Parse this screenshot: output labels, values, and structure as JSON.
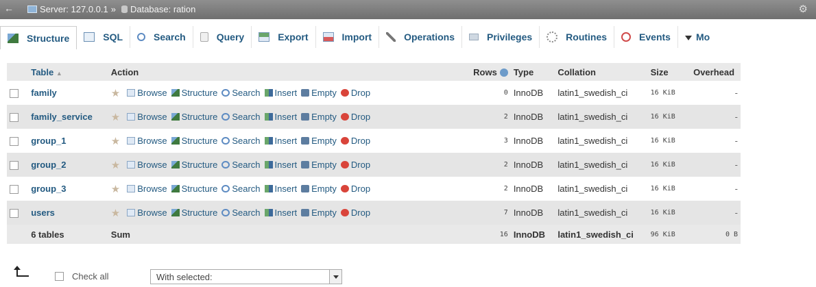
{
  "breadcrumb": {
    "server_label": "Server: 127.0.0.1",
    "separator": "»",
    "database_label": "Database: ration"
  },
  "tabs": [
    {
      "label": "Structure",
      "icon": "structure-icon",
      "active": true
    },
    {
      "label": "SQL",
      "icon": "sql-icon"
    },
    {
      "label": "Search",
      "icon": "search-icon"
    },
    {
      "label": "Query",
      "icon": "query-icon"
    },
    {
      "label": "Export",
      "icon": "export-icon"
    },
    {
      "label": "Import",
      "icon": "import-icon"
    },
    {
      "label": "Operations",
      "icon": "operations-icon"
    },
    {
      "label": "Privileges",
      "icon": "privileges-icon"
    },
    {
      "label": "Routines",
      "icon": "routines-icon"
    },
    {
      "label": "Events",
      "icon": "events-icon"
    },
    {
      "label": "Mo",
      "icon": "more-icon"
    }
  ],
  "table": {
    "headers": {
      "table": "Table",
      "sort_indicator": "▲",
      "action": "Action",
      "rows": "Rows",
      "type": "Type",
      "collation": "Collation",
      "size": "Size",
      "overhead": "Overhead"
    },
    "actions": {
      "browse": "Browse",
      "structure": "Structure",
      "search": "Search",
      "insert": "Insert",
      "empty": "Empty",
      "drop": "Drop"
    },
    "rows": [
      {
        "name": "family",
        "rows": "0",
        "type": "InnoDB",
        "collation": "latin1_swedish_ci",
        "size": "16 KiB",
        "overhead": "-"
      },
      {
        "name": "family_service",
        "rows": "2",
        "type": "InnoDB",
        "collation": "latin1_swedish_ci",
        "size": "16 KiB",
        "overhead": "-"
      },
      {
        "name": "group_1",
        "rows": "3",
        "type": "InnoDB",
        "collation": "latin1_swedish_ci",
        "size": "16 KiB",
        "overhead": "-"
      },
      {
        "name": "group_2",
        "rows": "2",
        "type": "InnoDB",
        "collation": "latin1_swedish_ci",
        "size": "16 KiB",
        "overhead": "-"
      },
      {
        "name": "group_3",
        "rows": "2",
        "type": "InnoDB",
        "collation": "latin1_swedish_ci",
        "size": "16 KiB",
        "overhead": "-"
      },
      {
        "name": "users",
        "rows": "7",
        "type": "InnoDB",
        "collation": "latin1_swedish_ci",
        "size": "16 KiB",
        "overhead": "-"
      }
    ],
    "summary": {
      "count": "6 tables",
      "label": "Sum",
      "rows": "16",
      "type": "InnoDB",
      "collation": "latin1_swedish_ci",
      "size": "96 KiB",
      "overhead": "0 B"
    }
  },
  "footer": {
    "check_all": "Check all",
    "with_selected": "With selected:"
  }
}
